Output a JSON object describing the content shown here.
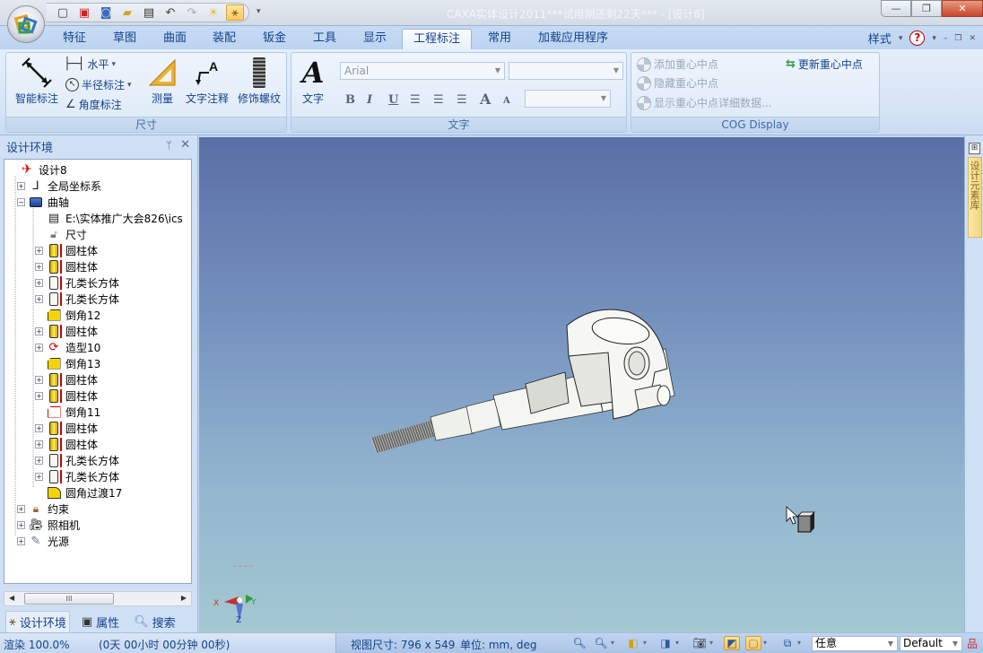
{
  "window": {
    "title": "CAXA实体设计2011***试用期还剩22天*** - [设计8]",
    "minimize_label": "—",
    "restore_label": "❐",
    "close_label": "✕"
  },
  "quick_access": {
    "items": [
      {
        "name": "new",
        "glyph": "🗋"
      },
      {
        "name": "new-drawing",
        "glyph": "▣"
      },
      {
        "name": "new-design",
        "glyph": "◙"
      },
      {
        "name": "open",
        "glyph": "📂"
      },
      {
        "name": "save",
        "glyph": "💾"
      },
      {
        "name": "undo",
        "glyph": "↶"
      },
      {
        "name": "redo",
        "glyph": "↷"
      },
      {
        "name": "light",
        "glyph": "☀"
      },
      {
        "name": "design-tree",
        "glyph": "⚹"
      }
    ],
    "more_label": "▾"
  },
  "tabs": [
    {
      "label": "特征",
      "active": false
    },
    {
      "label": "草图",
      "active": false
    },
    {
      "label": "曲面",
      "active": false
    },
    {
      "label": "装配",
      "active": false
    },
    {
      "label": "钣金",
      "active": false
    },
    {
      "label": "工具",
      "active": false
    },
    {
      "label": "显示",
      "active": false
    },
    {
      "label": "工程标注",
      "active": true
    },
    {
      "label": "常用",
      "active": false
    },
    {
      "label": "加载应用程序",
      "active": false
    }
  ],
  "tab_right": {
    "style_label": "样式",
    "help_label": "?"
  },
  "ribbon": {
    "dimension": {
      "label": "尺寸",
      "smart_dim": "智能标注",
      "horizontal": "水平",
      "radius_dim": "半径标注",
      "angle_dim": "角度标注",
      "measure": "测量",
      "text_annotation": "文字注释",
      "cosmetic_thread": "修饰螺纹"
    },
    "text": {
      "label": "文字",
      "text_button": "文字",
      "font_value": "Arial",
      "size_value": "",
      "style_value": "",
      "bold": "B",
      "italic": "I",
      "underline": "U",
      "grow": "A",
      "shrink": "A"
    },
    "cog": {
      "label": "COG Display",
      "add": "添加重心中点",
      "hide": "隐藏重心中点",
      "show_details": "显示重心中点详细数据...",
      "update": "更新重心中点"
    }
  },
  "left_panel": {
    "title": "设计环境",
    "pin_label": "ᛘ",
    "close_label": "✕",
    "tree": [
      {
        "label": "设计8",
        "level": 0,
        "expander": "none",
        "icon": "design"
      },
      {
        "label": "全局坐标系",
        "level": 1,
        "expander": "plus",
        "icon": "axes"
      },
      {
        "label": "曲轴",
        "level": 1,
        "expander": "minus",
        "icon": "part"
      },
      {
        "label": "E:\\实体推广大会826\\ics",
        "level": 2,
        "expander": "none",
        "icon": "doc"
      },
      {
        "label": "尺寸",
        "level": 2,
        "expander": "none",
        "icon": "lock"
      },
      {
        "label": "圆柱体",
        "level": 2,
        "expander": "plus",
        "icon": "cyl"
      },
      {
        "label": "圆柱体",
        "level": 2,
        "expander": "plus",
        "icon": "cyl"
      },
      {
        "label": "孔类长方体",
        "level": 2,
        "expander": "plus",
        "icon": "hole"
      },
      {
        "label": "孔类长方体",
        "level": 2,
        "expander": "plus",
        "icon": "hole"
      },
      {
        "label": "倒角12",
        "level": 2,
        "expander": "none",
        "icon": "chamfer"
      },
      {
        "label": "圆柱体",
        "level": 2,
        "expander": "plus",
        "icon": "cyl"
      },
      {
        "label": "造型10",
        "level": 2,
        "expander": "plus",
        "icon": "revolve"
      },
      {
        "label": "倒角13",
        "level": 2,
        "expander": "none",
        "icon": "chamfer"
      },
      {
        "label": "圆柱体",
        "level": 2,
        "expander": "plus",
        "icon": "cyl"
      },
      {
        "label": "圆柱体",
        "level": 2,
        "expander": "plus",
        "icon": "cyl"
      },
      {
        "label": "倒角11",
        "level": 2,
        "expander": "none",
        "icon": "chamfer-red"
      },
      {
        "label": "圆柱体",
        "level": 2,
        "expander": "plus",
        "icon": "cyl"
      },
      {
        "label": "圆柱体",
        "level": 2,
        "expander": "plus",
        "icon": "cyl"
      },
      {
        "label": "孔类长方体",
        "level": 2,
        "expander": "plus",
        "icon": "hole"
      },
      {
        "label": "孔类长方体",
        "level": 2,
        "expander": "plus",
        "icon": "hole"
      },
      {
        "label": "圆角过渡17",
        "level": 2,
        "expander": "none",
        "icon": "fillet"
      },
      {
        "label": "约束",
        "level": 1,
        "expander": "plus",
        "icon": "constraint"
      },
      {
        "label": "照相机",
        "level": 1,
        "expander": "plus",
        "icon": "camera"
      },
      {
        "label": "光源",
        "level": 1,
        "expander": "plus",
        "icon": "light"
      }
    ],
    "scroll_thumb": "III",
    "bottom_tabs": [
      {
        "label": "设计环境",
        "active": true
      },
      {
        "label": "属性",
        "active": false
      },
      {
        "label": "搜索",
        "active": false
      }
    ]
  },
  "right_strip": {
    "tab_label": "设计元素库"
  },
  "viewport": {
    "axis_x": "X",
    "axis_y": "Y",
    "axis_z": "Z"
  },
  "status": {
    "render": "渲染 100.0%",
    "elapsed": "(0天 00小时 00分钟 00秒)",
    "view_size": "视图尺寸: 796 x 549",
    "units": "单位: mm, deg",
    "select_mode": "任意",
    "style": "Default"
  }
}
